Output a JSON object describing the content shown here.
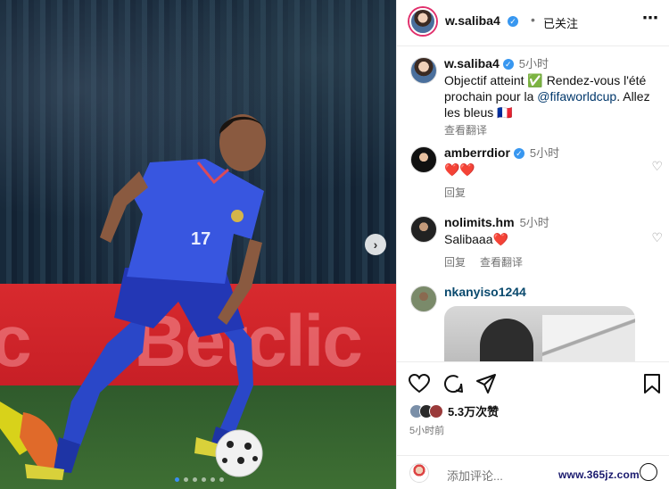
{
  "post": {
    "username": "w.saliba4",
    "separator": "•",
    "follow_status": "已关注",
    "more_icon": "more-horizontal-icon"
  },
  "caption": {
    "username": "w.saliba4",
    "time": "5小时",
    "text_before_link": "Objectif atteint ✅ Rendez-vous l'été prochain pour la ",
    "link": "@fifaworldcup",
    "text_after_link": ". Allez les bleus 🇫🇷",
    "translate": "查看翻译"
  },
  "comments": [
    {
      "username": "amberrdior",
      "verified": true,
      "time": "5小时",
      "text": "❤️❤️",
      "reply": "回复",
      "translate": ""
    },
    {
      "username": "nolimits.hm",
      "verified": false,
      "time": "5小时",
      "text": "Salibaaa❤️",
      "reply": "回复",
      "translate": "查看翻译"
    },
    {
      "username": "nkanyiso1244",
      "verified": false,
      "time": "",
      "text": "",
      "reply": "",
      "translate": ""
    }
  ],
  "actions": {
    "like_icon": "heart-icon",
    "comment_icon": "comment-icon",
    "share_icon": "send-icon",
    "save_icon": "bookmark-icon"
  },
  "likes": {
    "count": "5.3万次赞"
  },
  "post_time": "5小时前",
  "add_comment": {
    "placeholder": "添加评论..."
  },
  "media": {
    "board_text": "Betclic",
    "board_text_left": "c",
    "carousel_dots": 6,
    "active_dot": 0
  },
  "watermark": "www.365jz.com",
  "colors": {
    "accent_blue": "#3897f0",
    "link": "#00376b",
    "board_red": "#d82a2e",
    "kit_blue": "#2a47c8"
  }
}
